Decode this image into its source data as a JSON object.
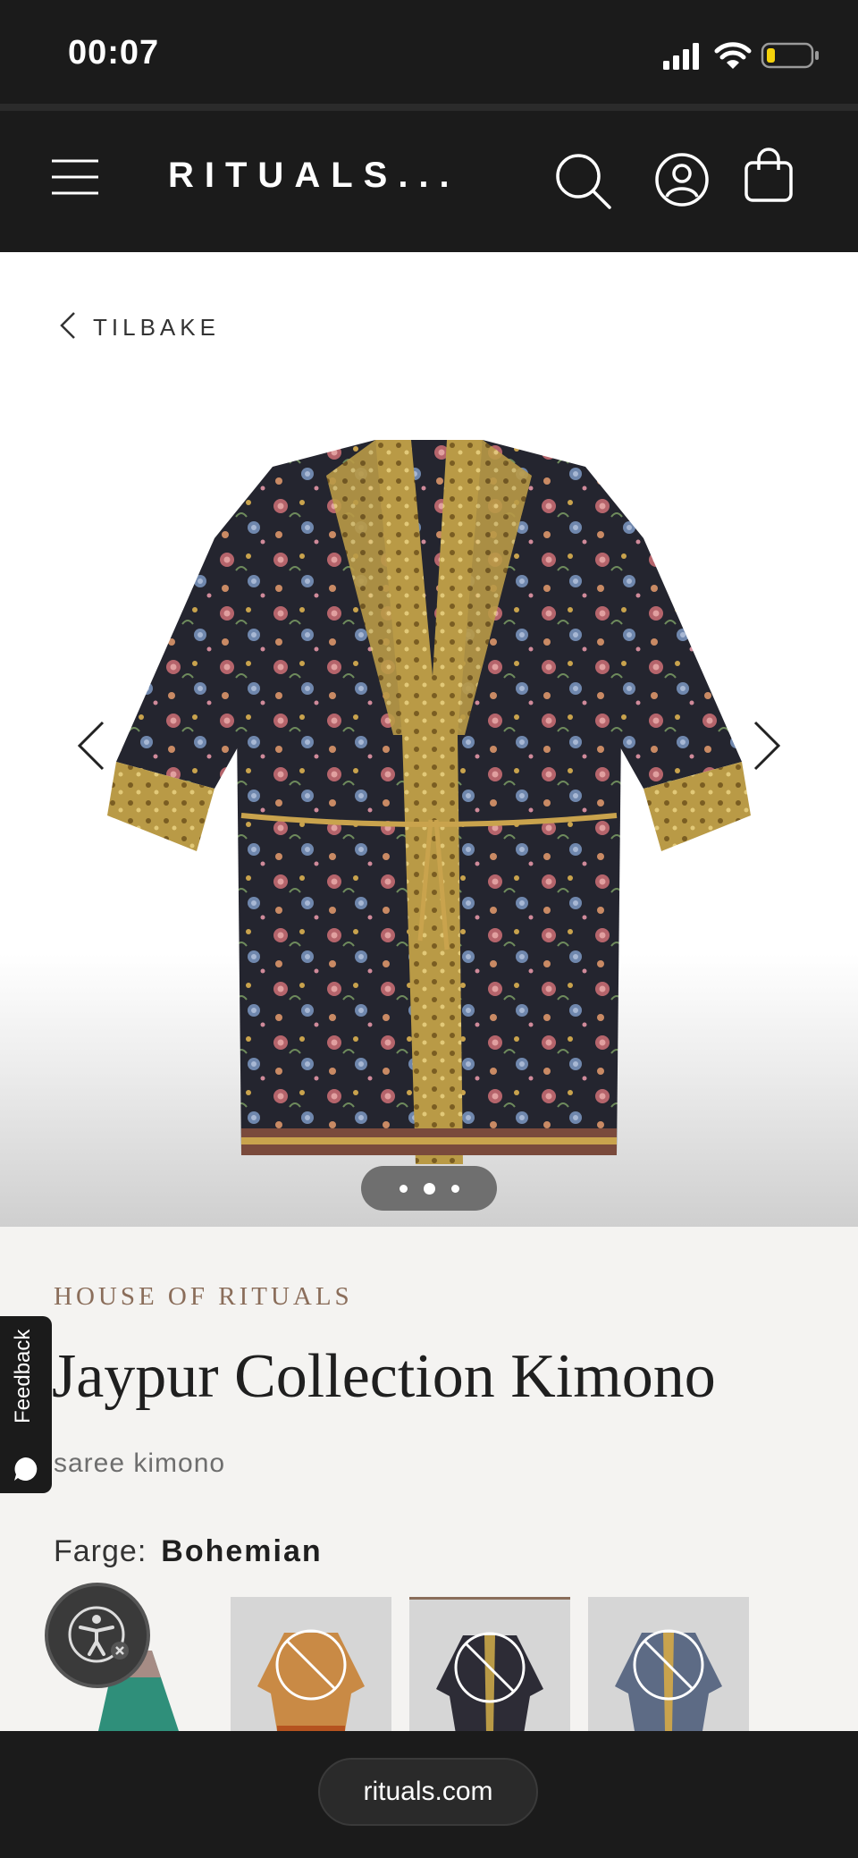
{
  "status_bar": {
    "time": "00:07",
    "battery_level": 0.2
  },
  "header": {
    "logo": "RITUALS...",
    "menu_icon": "hamburger-icon",
    "search_icon": "search-icon",
    "account_icon": "account-icon",
    "cart_icon": "shopping-bag-icon"
  },
  "back": {
    "label": "TILBAKE"
  },
  "gallery": {
    "total_dots": 3,
    "active_dot": 2,
    "prev_icon": "chevron-left-icon",
    "next_icon": "chevron-right-icon"
  },
  "product": {
    "brand": "HOUSE OF RITUALS",
    "title": "Jaypur Collection Kimono",
    "subtitle": "saree kimono",
    "color_label": "Farge:",
    "color_value": "Bohemian"
  },
  "swatches": [
    {
      "name": "green",
      "available": true
    },
    {
      "name": "orange",
      "available": false
    },
    {
      "name": "bohemian",
      "available": false,
      "selected": true
    },
    {
      "name": "blue",
      "available": false
    }
  ],
  "feedback": {
    "label": "Feedback"
  },
  "browser": {
    "url": "rituals.com"
  },
  "colors": {
    "dark": "#1b1b1b",
    "brand_accent": "#8a6d5a",
    "background": "#f4f3f1"
  }
}
